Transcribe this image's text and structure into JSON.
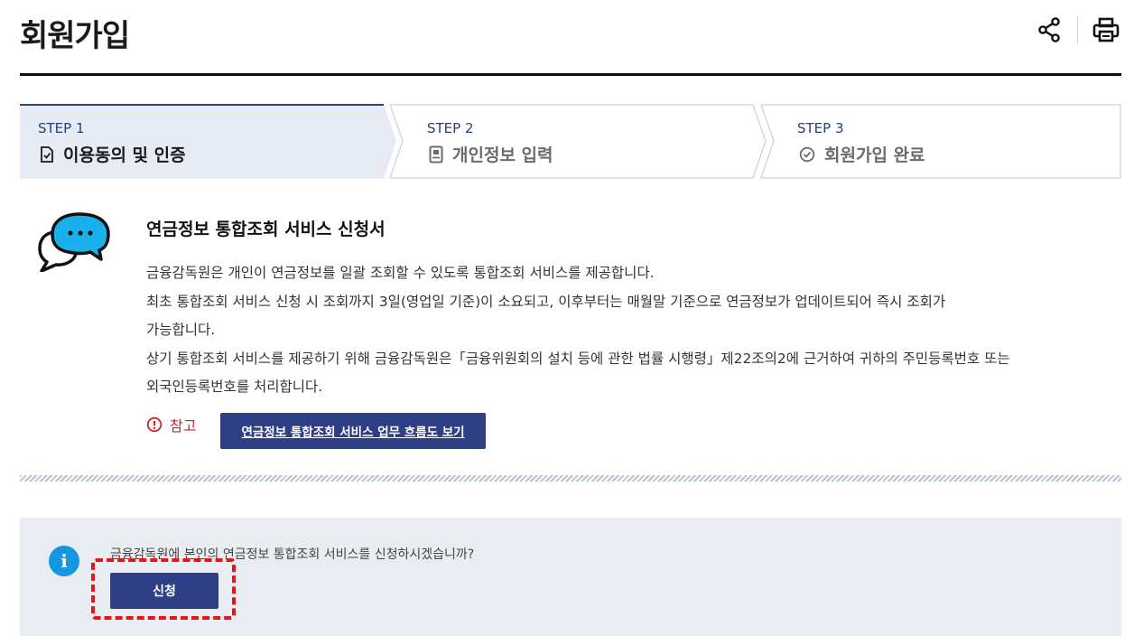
{
  "header": {
    "title": "회원가입",
    "share_icon": "share-icon",
    "print_icon": "print-icon"
  },
  "steps": [
    {
      "label": "STEP 1",
      "title": "이용동의 및 인증",
      "icon": "document-check-icon",
      "active": true
    },
    {
      "label": "STEP 2",
      "title": "개인정보 입력",
      "icon": "id-card-icon",
      "active": false
    },
    {
      "label": "STEP 3",
      "title": "회원가입 완료",
      "icon": "check-circle-icon",
      "active": false
    }
  ],
  "intro": {
    "title": "연금정보 통합조회 서비스 신청서",
    "lines": [
      "금융감독원은 개인이 연금정보를 일괄 조회할 수 있도록 통합조회 서비스를 제공합니다.",
      "최초 통합조회 서비스 신청 시 조회까지 3일(영업일 기준)이 소요되고, 이후부터는 매월말 기준으로 연금정보가 업데이트되어 즉시 조회가",
      "가능합니다.",
      "상기 통합조회 서비스를 제공하기 위해 금융감독원은「금융위원회의 설치 등에 관한 법률 시행령」제22조의2에 근거하여 귀하의 주민등록번호 또는",
      "외국인등록번호를 처리합니다."
    ],
    "note_label": "참고",
    "flow_button": "연금정보 통합조회 서비스 업무 흐름도 보기"
  },
  "confirm": {
    "question": "금융감독원에 본인의 연금정보 통합조회 서비스를 신청하시겠습니까?",
    "apply_button": "신청",
    "info_icon_text": "i"
  },
  "colors": {
    "brand_navy": "#2f3f86",
    "active_step_bg": "#e6ebf4",
    "step_border": "#c9d0dc",
    "alert_red": "#c8262e",
    "info_blue": "#1596e0",
    "highlight_red": "#e8141b"
  }
}
